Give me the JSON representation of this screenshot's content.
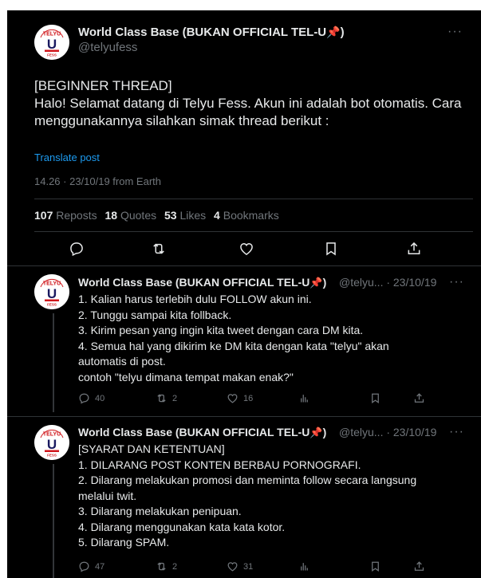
{
  "main_post": {
    "author_name": "World Class Base (BUKAN OFFICIAL TEL-U",
    "author_emoji": "📌",
    "author_suffix": ")",
    "handle": "@telyufess",
    "more_label": "···",
    "lines": [
      "[BEGINNER THREAD]",
      "Halo! Selamat datang di Telyu Fess. Akun ini adalah bot otomatis. Cara",
      "menggunakannya silahkan simak thread berikut :"
    ],
    "translate_label": "Translate post",
    "timestamp": "14.26 · 23/10/19 from Earth",
    "stats": {
      "reposts_count": "107",
      "reposts_label": "Reposts",
      "quotes_count": "18",
      "quotes_label": "Quotes",
      "likes_count": "53",
      "likes_label": "Likes",
      "bookmarks_count": "4",
      "bookmarks_label": "Bookmarks"
    }
  },
  "avatar_text": {
    "top": "TELYU",
    "letter": "U",
    "bottom": "FESS"
  },
  "replies": [
    {
      "author_name": "World Class Base (BUKAN OFFICIAL TEL-U",
      "author_emoji": "📌",
      "author_suffix": ")",
      "handle_date": "@telyu... · 23/10/19",
      "more_label": "···",
      "lines": [
        "1. Kalian harus terlebih dulu FOLLOW akun ini.",
        "2. Tunggu sampai kita follback.",
        "3. Kirim pesan yang ingin kita tweet dengan cara DM kita.",
        "4. Semua hal yang dikirim ke DM kita dengan kata \"telyu\" akan",
        "automatis di post.",
        "contoh \"telyu dimana tempat makan enak?\""
      ],
      "reply_count": "40",
      "repost_count": "2",
      "like_count": "16"
    },
    {
      "author_name": "World Class Base (BUKAN OFFICIAL TEL-U",
      "author_emoji": "📌",
      "author_suffix": ")",
      "handle_date": "@telyu... · 23/10/19",
      "more_label": "···",
      "lines": [
        "[SYARAT DAN KETENTUAN]",
        "1. DILARANG POST KONTEN BERBAU PORNOGRAFI.",
        "2. Dilarang melakukan promosi dan meminta follow secara langsung",
        "melalui twit.",
        "3. Dilarang melakukan penipuan.",
        "4. Dilarang menggunakan kata kata kotor.",
        "5. Dilarang SPAM."
      ],
      "reply_count": "47",
      "repost_count": "2",
      "like_count": "31"
    }
  ],
  "colors": {
    "background": "#000000",
    "text": "#e7e9ea",
    "muted": "#71767b",
    "link": "#1d9bf0",
    "divider": "#2f3336",
    "avatar_red": "#d0161b"
  }
}
